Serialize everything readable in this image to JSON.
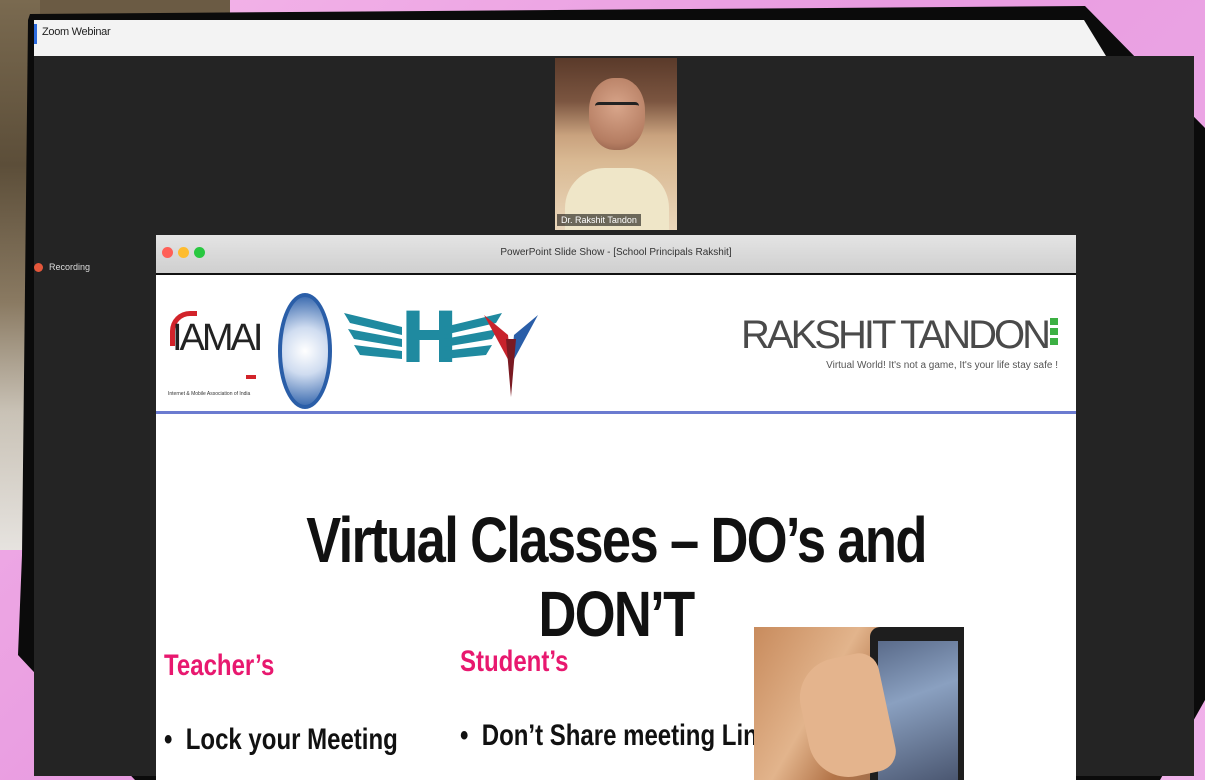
{
  "window": {
    "title": "Zoom Webinar"
  },
  "side": {
    "recording_label": "Recording"
  },
  "speaker": {
    "name_tag": "Dr. Rakshit Tandon"
  },
  "ppt": {
    "title": "PowerPoint Slide Show - [School Principals Rakshit]",
    "dots": [
      "#ff5f57",
      "#febc2e",
      "#28c840"
    ]
  },
  "slide": {
    "logo_iamai": "IAMAI",
    "logo_iamai_sub": "Internet & Mobile Association of India",
    "logo_h": "H",
    "brand_name": "RAKSHIT TANDON",
    "brand_tag": "Virtual World! It's not a game, It's your life stay safe !",
    "title": "Virtual Classes – DO’s and DON’T",
    "col1_head": "Teacher’s",
    "col1_bullet": "Lock your Meeting",
    "col2_head": "Student’s",
    "col2_bullet": "Don’t Share meeting Link",
    "bullet_glyph": "•"
  }
}
